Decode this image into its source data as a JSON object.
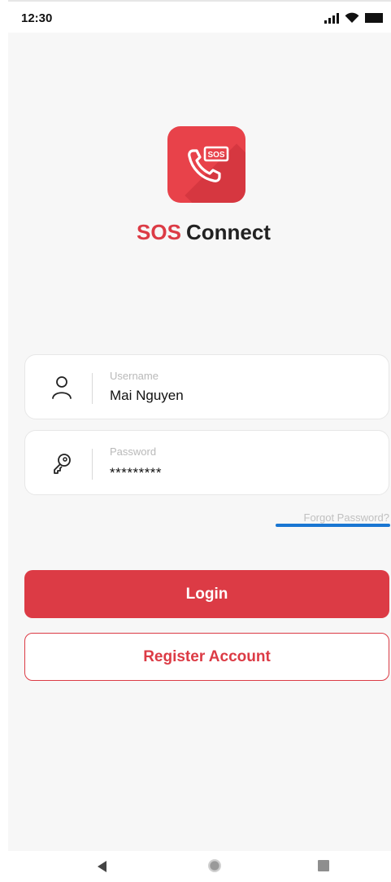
{
  "status_bar": {
    "time": "12:30",
    "icons": [
      "signal-icon",
      "wifi-icon",
      "battery-icon"
    ]
  },
  "app": {
    "brand_primary": "SOS",
    "brand_secondary": "Connect",
    "logo_text": "SOS",
    "accent_color": "#dc3b45"
  },
  "form": {
    "username": {
      "label": "Username",
      "value": "Mai Nguyen",
      "icon": "user-icon"
    },
    "password": {
      "label": "Password",
      "value": "*********",
      "icon": "key-icon"
    },
    "forgot_label": "Forgot Password?"
  },
  "buttons": {
    "login": "Login",
    "register": "Register Account"
  },
  "nav_bar": {
    "icons": [
      "back-icon",
      "home-icon",
      "recent-apps-icon"
    ]
  }
}
